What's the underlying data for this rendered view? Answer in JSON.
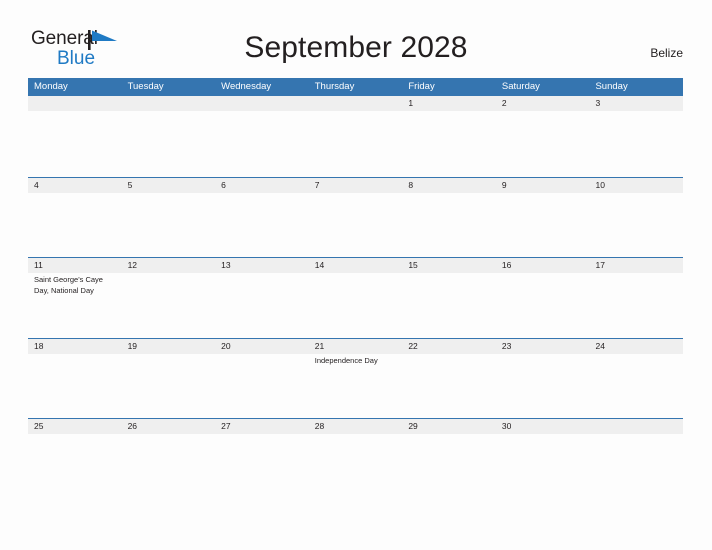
{
  "brand": {
    "word_one": "General",
    "word_two": "Blue",
    "flag_icon": "blue-pennant-icon",
    "word_one_color": "#231f20",
    "word_two_color": "#1f7ac4"
  },
  "header": {
    "title": "September 2028",
    "region": "Belize"
  },
  "theme": {
    "header_blue": "#3575b0",
    "date_band_gray": "#efefef",
    "page_background": "#fdfdfd",
    "text_color": "#231f20"
  },
  "calendar": {
    "month": "September",
    "year": "2028",
    "day_headers": [
      "Monday",
      "Tuesday",
      "Wednesday",
      "Thursday",
      "Friday",
      "Saturday",
      "Sunday"
    ],
    "weeks": [
      [
        {
          "date": "",
          "events": ""
        },
        {
          "date": "",
          "events": ""
        },
        {
          "date": "",
          "events": ""
        },
        {
          "date": "",
          "events": ""
        },
        {
          "date": "1",
          "events": ""
        },
        {
          "date": "2",
          "events": ""
        },
        {
          "date": "3",
          "events": ""
        }
      ],
      [
        {
          "date": "4",
          "events": ""
        },
        {
          "date": "5",
          "events": ""
        },
        {
          "date": "6",
          "events": ""
        },
        {
          "date": "7",
          "events": ""
        },
        {
          "date": "8",
          "events": ""
        },
        {
          "date": "9",
          "events": ""
        },
        {
          "date": "10",
          "events": ""
        }
      ],
      [
        {
          "date": "11",
          "events": "Saint George's Caye Day, National Day"
        },
        {
          "date": "12",
          "events": ""
        },
        {
          "date": "13",
          "events": ""
        },
        {
          "date": "14",
          "events": ""
        },
        {
          "date": "15",
          "events": ""
        },
        {
          "date": "16",
          "events": ""
        },
        {
          "date": "17",
          "events": ""
        }
      ],
      [
        {
          "date": "18",
          "events": ""
        },
        {
          "date": "19",
          "events": ""
        },
        {
          "date": "20",
          "events": ""
        },
        {
          "date": "21",
          "events": "Independence Day"
        },
        {
          "date": "22",
          "events": ""
        },
        {
          "date": "23",
          "events": ""
        },
        {
          "date": "24",
          "events": ""
        }
      ],
      [
        {
          "date": "25",
          "events": ""
        },
        {
          "date": "26",
          "events": ""
        },
        {
          "date": "27",
          "events": ""
        },
        {
          "date": "28",
          "events": ""
        },
        {
          "date": "29",
          "events": ""
        },
        {
          "date": "30",
          "events": ""
        },
        {
          "date": "",
          "events": ""
        }
      ]
    ]
  }
}
